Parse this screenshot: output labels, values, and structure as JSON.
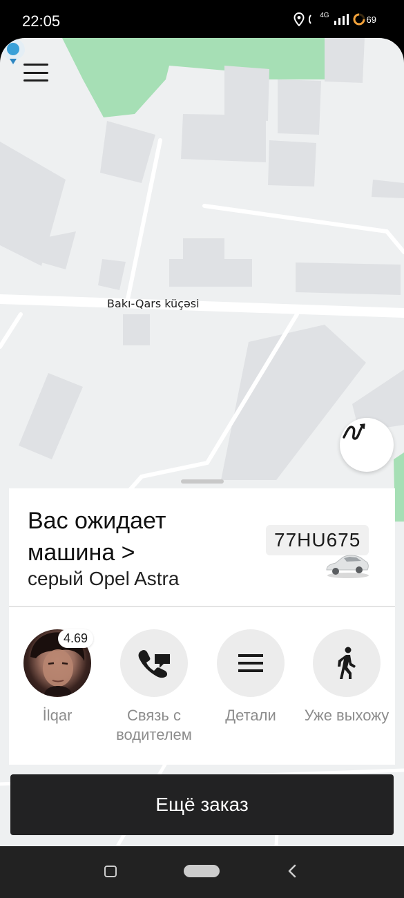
{
  "status_bar": {
    "time": "22:05",
    "network": "4G",
    "battery": "69",
    "icons": [
      "location-icon",
      "wifi-calling-icon",
      "signal-icon",
      "battery-icon"
    ]
  },
  "map": {
    "street_label": "Bakı-Qars küçəsi",
    "icons": [
      "menu-icon",
      "route-icon",
      "location-pin-icon"
    ]
  },
  "ride": {
    "title": "Вас ожидает машина >",
    "car": "серый Opel Astra",
    "plate": "77HU675"
  },
  "actions": [
    {
      "label": "İlqar",
      "icon": "avatar",
      "rating": "4.69"
    },
    {
      "label": "Связь с водителем",
      "icon": "phone-icon"
    },
    {
      "label": "Детали",
      "icon": "list-icon"
    },
    {
      "label": "Уже выхожу",
      "icon": "walking-icon"
    }
  ],
  "order_button": "Ещё заказ",
  "nav": {
    "icons": [
      "recent-apps-icon",
      "home-icon",
      "back-icon"
    ]
  },
  "colors": {
    "map_bg": "#eef0f1",
    "park": "#a6dfb5",
    "button_dark": "#222223"
  }
}
